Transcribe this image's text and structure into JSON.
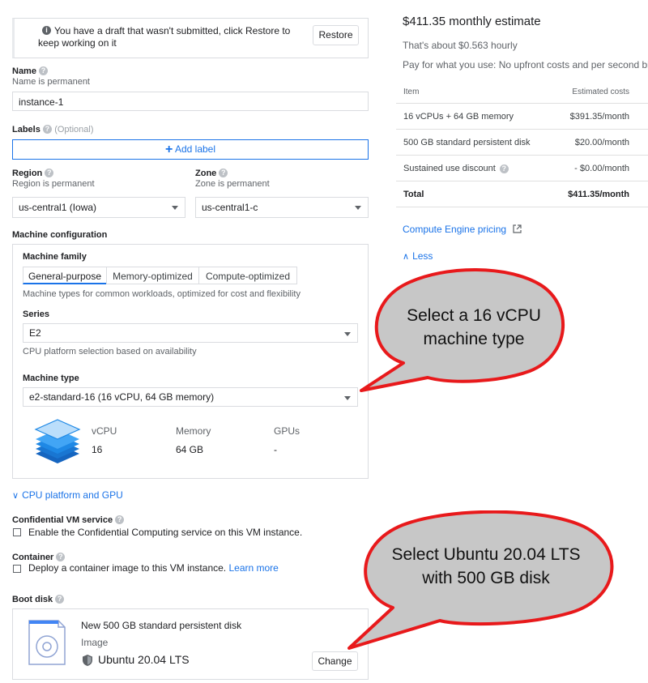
{
  "draft_banner": {
    "icon": "info-icon",
    "text": "You have a draft that wasn't submitted, click Restore to keep working on it",
    "restore_label": "Restore"
  },
  "name": {
    "label": "Name",
    "hint": "Name is permanent",
    "value": "instance-1"
  },
  "labels": {
    "label": "Labels",
    "optional": "(Optional)",
    "add_label": "Add label"
  },
  "region": {
    "label": "Region",
    "hint": "Region is permanent",
    "value": "us-central1 (Iowa)"
  },
  "zone": {
    "label": "Zone",
    "hint": "Zone is permanent",
    "value": "us-central1-c"
  },
  "machine_config": {
    "title": "Machine configuration",
    "family_label": "Machine family",
    "tabs": [
      "General-purpose",
      "Memory-optimized",
      "Compute-optimized"
    ],
    "family_desc": "Machine types for common workloads, optimized for cost and flexibility",
    "series_label": "Series",
    "series_value": "E2",
    "series_desc": "CPU platform selection based on availability",
    "machine_type_label": "Machine type",
    "machine_type_value": "e2-standard-16 (16 vCPU, 64 GB memory)",
    "specs": {
      "vcpu_label": "vCPU",
      "vcpu_value": "16",
      "memory_label": "Memory",
      "memory_value": "64 GB",
      "gpus_label": "GPUs",
      "gpus_value": "-"
    }
  },
  "cpu_platform_link": "CPU platform and GPU",
  "confidential": {
    "label": "Confidential VM service",
    "checkbox_text": "Enable the Confidential Computing service on this VM instance."
  },
  "container": {
    "label": "Container",
    "checkbox_text": "Deploy a container image to this VM instance.",
    "learn_more": "Learn more"
  },
  "boot_disk": {
    "label": "Boot disk",
    "title": "New 500 GB standard persistent disk",
    "image_label": "Image",
    "image_value": "Ubuntu 20.04 LTS",
    "change_label": "Change"
  },
  "estimate": {
    "title": "$411.35 monthly estimate",
    "hourly": "That's about $0.563 hourly",
    "pay_note": "Pay for what you use: No upfront costs and per second bi",
    "col_item": "Item",
    "col_cost": "Estimated costs",
    "rows": [
      {
        "item": "16 vCPUs + 64 GB memory",
        "cost": "$391.35/month"
      },
      {
        "item": "500 GB standard persistent disk",
        "cost": "$20.00/month"
      },
      {
        "item": "Sustained use discount",
        "cost": "- $0.00/month"
      }
    ],
    "total_label": "Total",
    "total_value": "$411.35/month",
    "pricing_link": "Compute Engine pricing",
    "less_link": "Less"
  },
  "callouts": {
    "bubble1": [
      "Select a 16 vCPU",
      "machine type"
    ],
    "bubble2": [
      "Select Ubuntu 20.04 LTS",
      "with 500 GB disk"
    ],
    "fill_color": "#c7c7c7",
    "border_color": "#e8191b"
  },
  "colors": {
    "accent": "#1a73e8",
    "text": "#202124"
  }
}
